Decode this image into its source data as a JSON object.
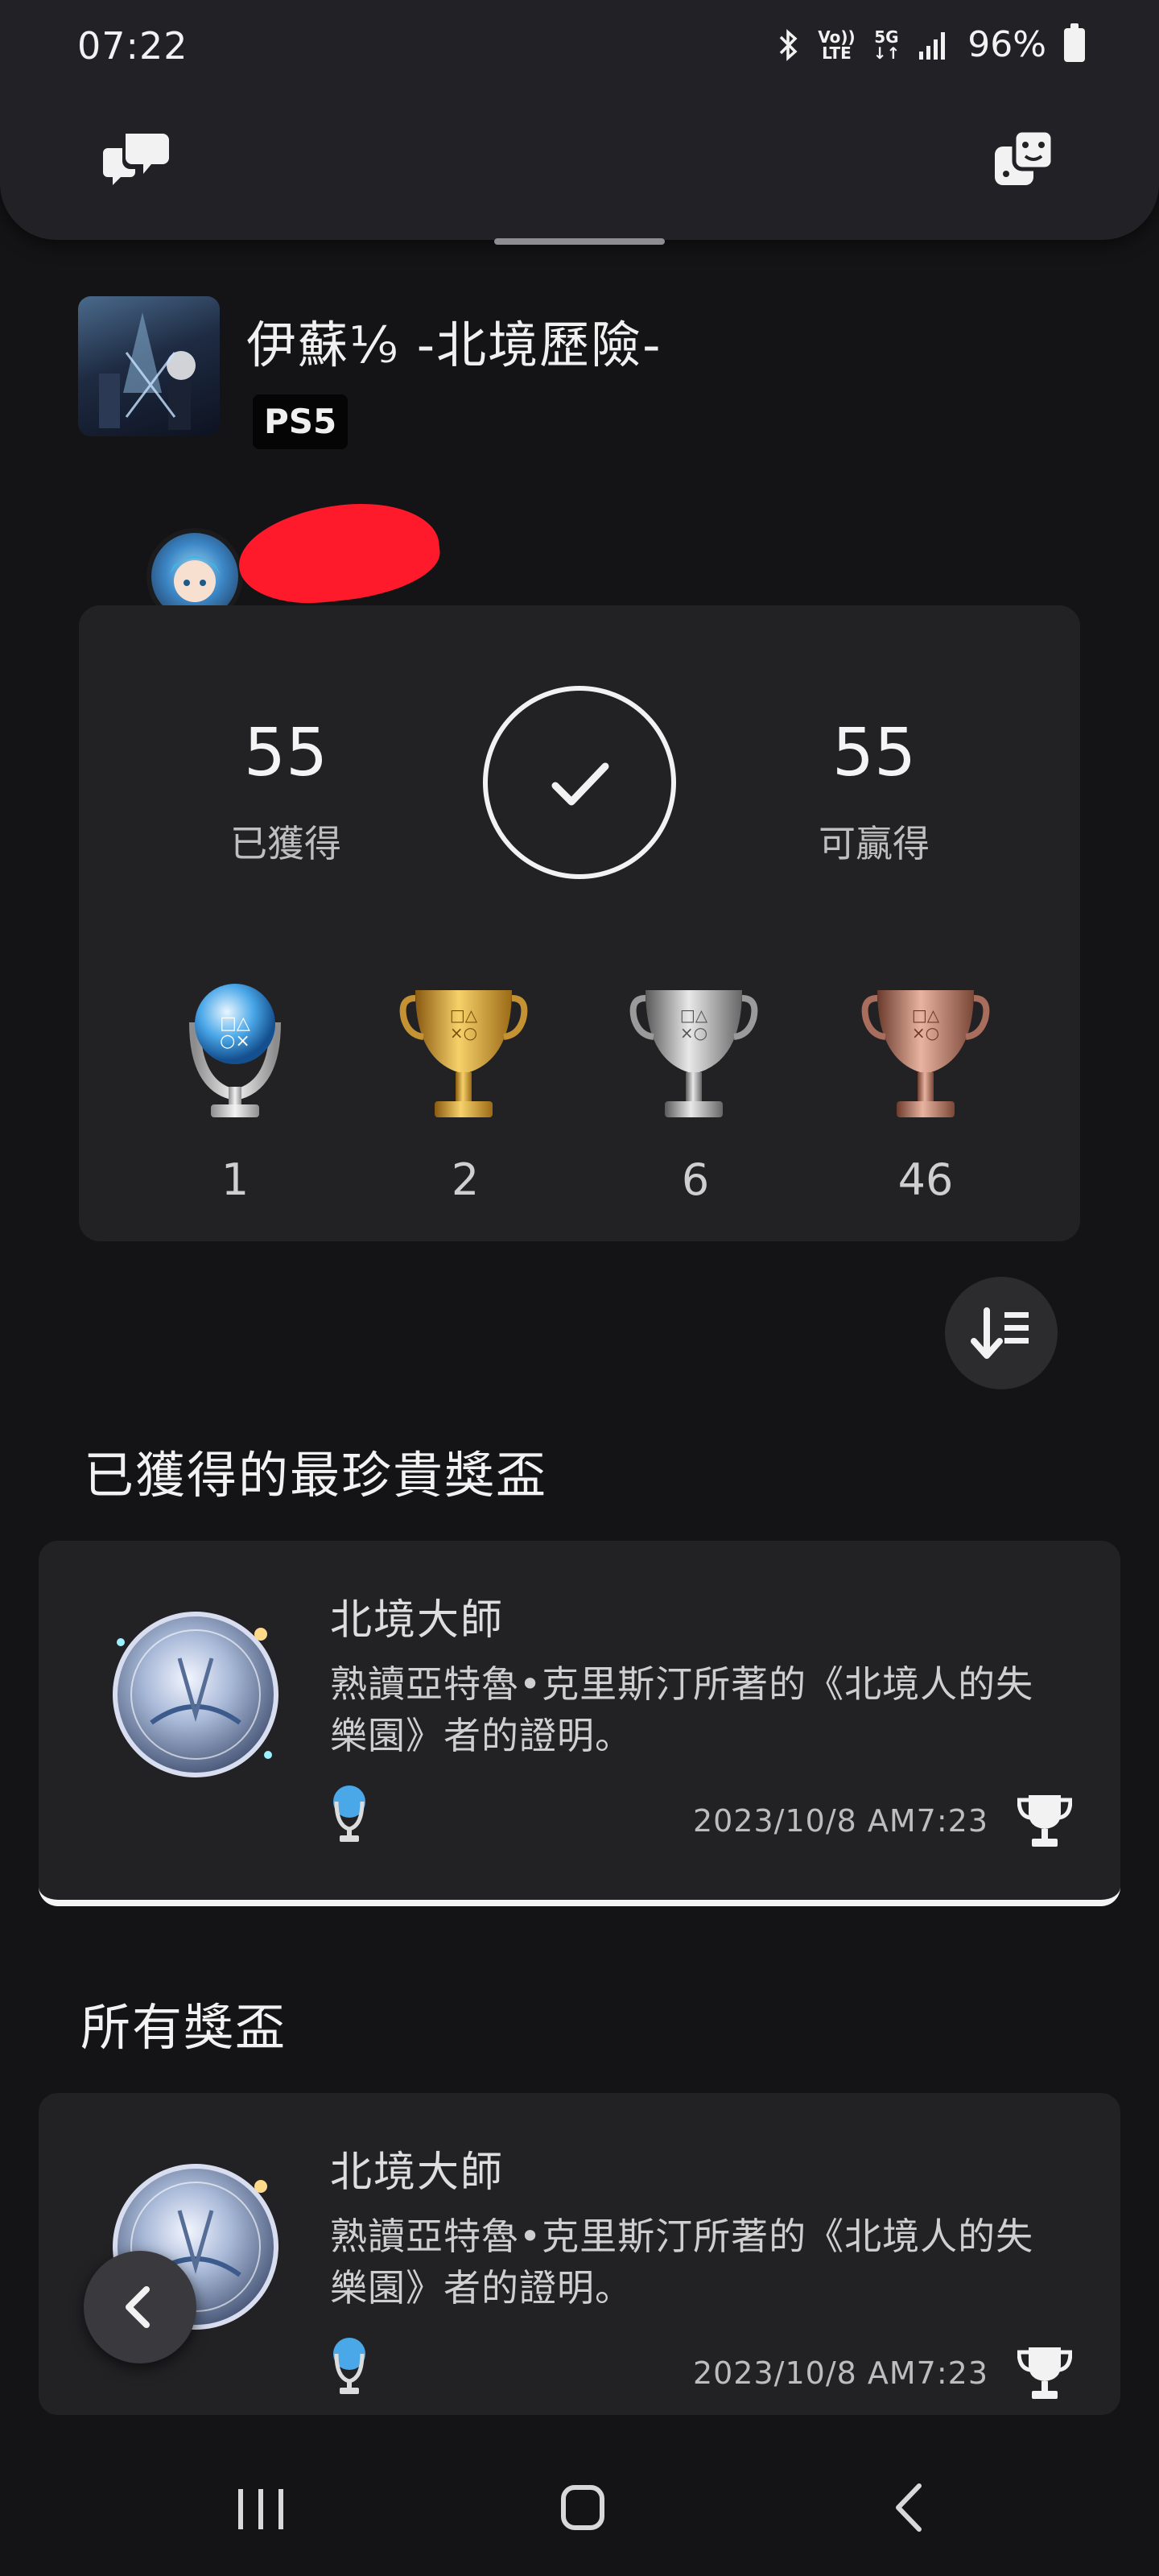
{
  "status_bar": {
    "time": "07:22",
    "volte_line1": "Vo))",
    "volte_line2": "LTE",
    "net_line1": "5G",
    "net_line2": "↓↑",
    "battery": "96%",
    "icons": [
      "bluetooth-icon",
      "volte-icon",
      "5g-icon",
      "signal-icon",
      "battery-icon"
    ]
  },
  "header": {
    "left_icon": "chat-bubbles-icon",
    "right_icon": "game-icon"
  },
  "game": {
    "title": "伊蘇⅑ -北境歷險-",
    "platform": "PS5"
  },
  "user": {
    "avatar_icon": "user-avatar"
  },
  "stats": {
    "earned": "55",
    "earned_label": "已獲得",
    "available": "55",
    "available_label": "可贏得",
    "complete_icon": "checkmark-icon",
    "trophies": [
      {
        "type": "platinum",
        "count": "1",
        "color": "#9fd0ef"
      },
      {
        "type": "gold",
        "count": "2",
        "color": "#d9a62e"
      },
      {
        "type": "silver",
        "count": "6",
        "color": "#b9b9b9"
      },
      {
        "type": "bronze",
        "count": "46",
        "color": "#c98b78"
      }
    ]
  },
  "sort_button": {
    "icon": "sort-icon"
  },
  "sections": {
    "rarest_title": "已獲得的最珍貴獎盃",
    "all_title": "所有獎盃"
  },
  "rarest_trophy": {
    "name": "北境大師",
    "description": "熟讀亞特魯•克里斯汀所著的《北境人的失樂園》者的證明。",
    "date": "2023/10/8 AM7:23",
    "grade_icon": "platinum-trophy-icon",
    "status_icon": "trophy-icon"
  },
  "all_trophies": [
    {
      "name": "北境大師",
      "description": "熟讀亞特魯•克里斯汀所著的《北境人的失樂園》者的證明。",
      "date": "2023/10/8 AM7:23",
      "grade_icon": "platinum-trophy-icon",
      "status_icon": "trophy-icon"
    }
  ],
  "floating": {
    "back_icon": "chevron-left-icon"
  },
  "navbar": {
    "icons": [
      "recent-apps-icon",
      "home-icon",
      "back-icon"
    ]
  },
  "colors": {
    "background": "#141416",
    "card": "#222225",
    "redaction": "#ff1a2b"
  }
}
